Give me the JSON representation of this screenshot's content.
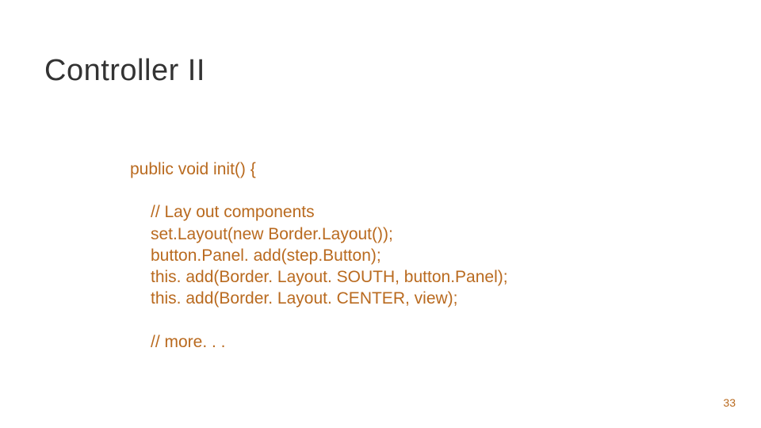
{
  "title": "Controller II",
  "code": {
    "line1": "public void init() {",
    "line2": "// Lay out components",
    "line3": "set.Layout(new Border.Layout());",
    "line4": "button.Panel. add(step.Button);",
    "line5": "this. add(Border. Layout. SOUTH, button.Panel);",
    "line6": "this. add(Border. Layout. CENTER, view);",
    "line7": "// more. . ."
  },
  "page_number": "33"
}
